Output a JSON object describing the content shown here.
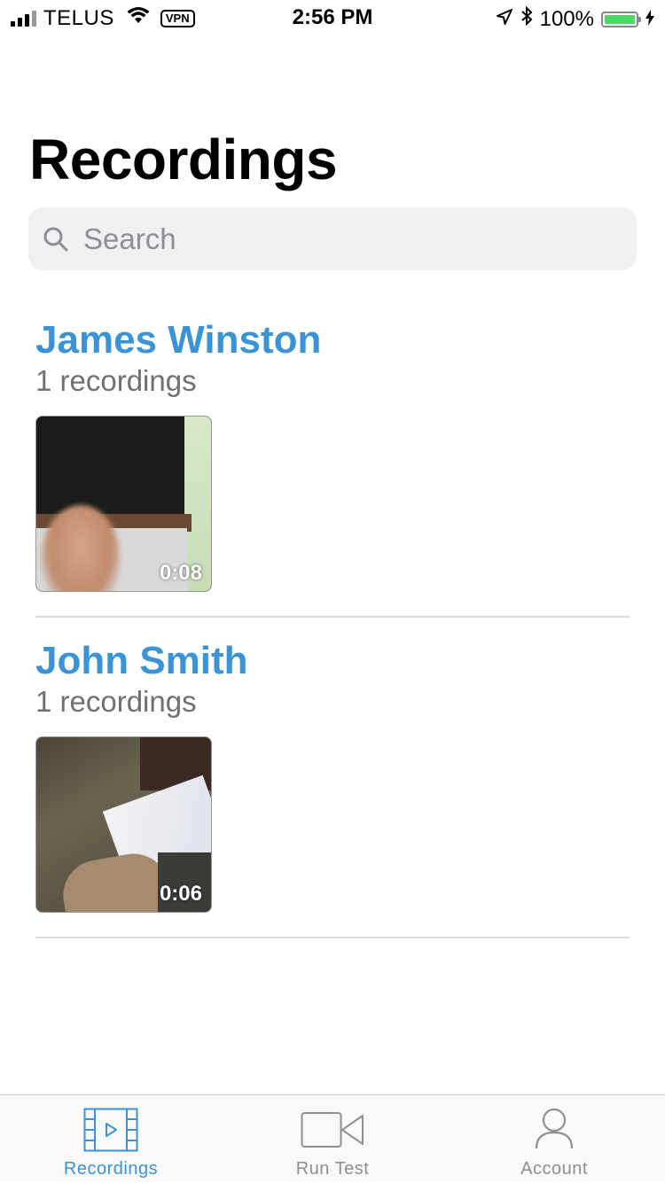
{
  "status_bar": {
    "carrier": "TELUS",
    "vpn": "VPN",
    "time": "2:56 PM",
    "battery": "100%"
  },
  "page": {
    "title": "Recordings"
  },
  "search": {
    "placeholder": "Search"
  },
  "groups": [
    {
      "name": "James Winston",
      "count": "1 recordings",
      "recordings": [
        {
          "duration": "0:08"
        }
      ]
    },
    {
      "name": "John Smith",
      "count": "1 recordings",
      "recordings": [
        {
          "duration": "0:06"
        }
      ]
    }
  ],
  "tab_bar": {
    "tabs": [
      {
        "label": "Recordings",
        "icon": "film-icon",
        "active": true
      },
      {
        "label": "Run Test",
        "icon": "video-camera-icon",
        "active": false
      },
      {
        "label": "Account",
        "icon": "person-icon",
        "active": false
      }
    ]
  },
  "colors": {
    "accent": "#3a93d7",
    "battery": "#4cd964"
  }
}
